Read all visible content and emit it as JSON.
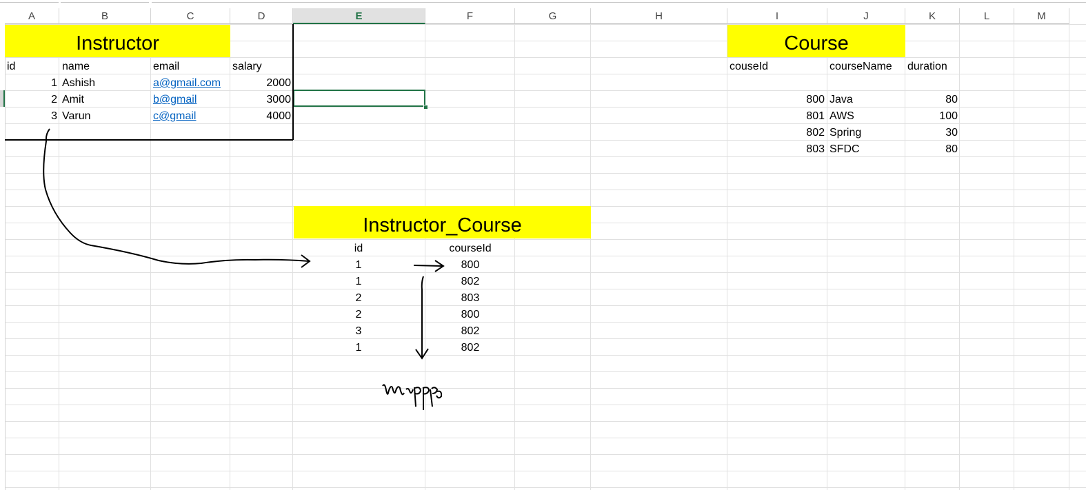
{
  "columns": [
    {
      "label": "A"
    },
    {
      "label": "B"
    },
    {
      "label": "C"
    },
    {
      "label": "D"
    },
    {
      "label": "E"
    },
    {
      "label": "F"
    },
    {
      "label": "G"
    },
    {
      "label": "H"
    },
    {
      "label": "I"
    },
    {
      "label": "J"
    },
    {
      "label": "K"
    },
    {
      "label": "L"
    },
    {
      "label": "M"
    }
  ],
  "selected_column": "E",
  "instructor": {
    "title": "Instructor",
    "headers": [
      "id",
      "name",
      "email",
      "salary"
    ],
    "rows": [
      {
        "id": "1",
        "name": "Ashish",
        "email": "a@gmail.com",
        "salary": "2000"
      },
      {
        "id": "2",
        "name": "Amit",
        "email": "b@gmail",
        "salary": "3000"
      },
      {
        "id": "3",
        "name": "Varun",
        "email": "c@gmail",
        "salary": "4000"
      }
    ]
  },
  "course": {
    "title": "Course",
    "headers": [
      "couseId",
      "courseName",
      "duration"
    ],
    "rows": [
      {
        "id": "800",
        "name": "Java",
        "duration": "80"
      },
      {
        "id": "801",
        "name": "AWS",
        "duration": "100"
      },
      {
        "id": "802",
        "name": "Spring",
        "duration": "30"
      },
      {
        "id": "803",
        "name": "SFDC",
        "duration": "80"
      }
    ]
  },
  "instructor_course": {
    "title": "Instructor_Course",
    "headers": [
      "id",
      "courseId"
    ],
    "rows": [
      {
        "id": "1",
        "courseId": "800"
      },
      {
        "id": "1",
        "courseId": "802"
      },
      {
        "id": "2",
        "courseId": "803"
      },
      {
        "id": "2",
        "courseId": "800"
      },
      {
        "id": "3",
        "courseId": "802"
      },
      {
        "id": "1",
        "courseId": "802"
      }
    ]
  },
  "colors": {
    "banner": "#ffff00",
    "selection": "#217346",
    "link": "#0563c1",
    "gridline": "#e0e0e0"
  }
}
